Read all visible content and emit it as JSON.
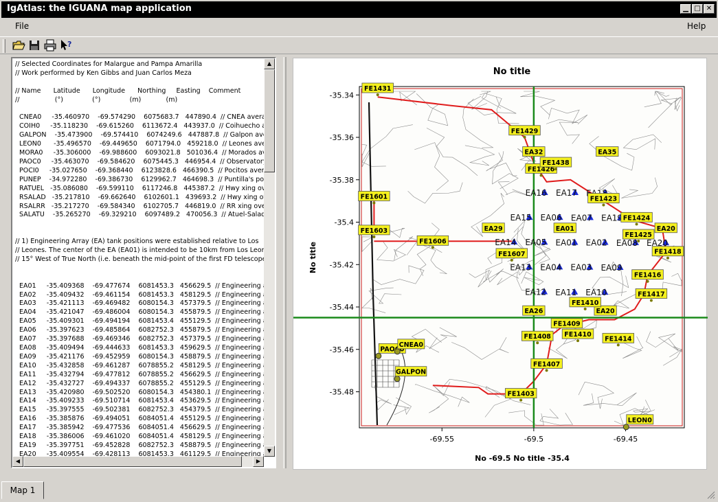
{
  "window": {
    "title": "IgAtlas: the IGUANA map application",
    "controls": {
      "minimize": "▁",
      "maximize": "□",
      "close": "✕"
    }
  },
  "menu": {
    "file": "File",
    "help": "Help"
  },
  "toolbar": {
    "icons": [
      "open-folder-icon",
      "save-disk-icon",
      "print-icon",
      "context-help-icon"
    ]
  },
  "text_lines": [
    "// Selected Coordinates for Malargue and Pampa Amarilla",
    "// Work performed by Ken Gibbs and Juan Carlos Meza",
    "",
    "// Name      Latitude      Longitude      Northing     Easting    Comment",
    "//                 (°)              (°)              (m)            (m)",
    "",
    "  CNEA0     -35.460970    -69.574290    6075683.7   447890.4  // CNEA averag",
    "  COIH0     -35.118230    -69.615260    6113672.4   443937.0  // Coihuecho aver",
    "  GALPON    -35.473900    -69.574410    6074249.6   447887.8  // Galpon avera",
    "  LEON0      -35.496570    -69.449650    6071794.0   459218.0  // Leones averag",
    "  MORA0     -35.306000    -69.988600    6093021.8   501036.4  // Morados aver",
    "  PAOC0     -35.463070    -69.584620    6075445.3   446954.4  // Observatory C",
    "  POCI0     -35.027650    -69.368440    6123828.6   466390.5  // Pocitos averag",
    "  PUNEP    -34.972280    -69.386730    6129962.7   464698.3  // Puntilla's pos",
    "  RATUEL   -35.086080    -69.599110    6117246.8   445387.2  // Hwy xing ove",
    "  RSALAD   -35.217810    -69.662640    6102601.1   439693.2  // Hwy xing over",
    "  RSALRR   -35.217270    -69.584340    6102705.7   446819.0  // RR xing over",
    "  SALATU    -35.265270    -69.329210    6097489.2   470056.3  // Atuel-Salado",
    "",
    "",
    "// 1) Engineering Array (EA) tank positions were established relative to Los",
    "// Leones. The center of the EA (EA01) is intended to be 10km from Los Leones,",
    "// 15° West of True North (i.e. beneath the mid-point of the first FD telescope's a",
    "",
    "",
    "  EA01     -35.409368    -69.477674    6081453.3   456629.5  // Engineering arr",
    "  EA02     -35.409432    -69.461154    6081453.3   458129.5  // Engineering arr",
    "  EA03     -35.421113    -69.469482    6080154.3   457379.5  // Engineering arr",
    "  EA04     -35.421047    -69.486004    6080154.3   455879.5  // Engineering arr",
    "  EA05     -35.409301    -69.494194    6081453.4   455129.5  // Engineering arr",
    "  EA06     -35.397623    -69.485864    6082752.3   455879.5  // Engineering arr",
    "  EA07     -35.397688    -69.469346    6082752.3   457379.5  // Engineering arr",
    "  EA08     -35.409494    -69.444633    6081453.3   459629.5  // Engineering arr",
    "  EA09     -35.421176    -69.452959    6080154.3   458879.5  // Engineering arr",
    "  EA10     -35.432858    -69.461287    6078855.2   458129.5  // Engineering arr",
    "  EA11     -35.432794    -69.477812    6078855.2   456629.5  // Engineering arr",
    "  EA12     -35.432727    -69.494337    6078855.2   455129.5  // Engineering arr",
    "  EA13     -35.420980    -69.502520    6080154.3   454380.1  // Engineering arr",
    "  EA14     -35.409233    -69.510714    6081453.4   453629.5  // Engineering arr",
    "  EA15     -35.397555    -69.502381    6082752.3   454379.5  // Engineering arr",
    "  EA16     -35.385876    -69.494051    6084051.4   455129.5  // Engineering arr",
    "  EA17     -35.385942    -69.477536    6084051.4   456629.5  // Engineering arr",
    "  EA18     -35.386006    -69.461020    6084051.4   458129.5  // Engineering arr",
    "  EA19     -35.397751    -69.452828    6082752.3   458879.5  // Engineering arr",
    "  EA20     -35.409554    -69.428113    6081453.3   461129.5  // Engineering arr"
  ],
  "map": {
    "title": "No title",
    "ylabel": "No title",
    "xlabel": "No -69.5 No title -35.4",
    "xticks": [
      "-69.55",
      "-69.5",
      "-69.45"
    ],
    "yticks": [
      "-35.34",
      "-35.36",
      "-35.38",
      "-35.4",
      "-35.42",
      "-35.44",
      "-35.46",
      "-35.48"
    ],
    "crosshair": {
      "lon": -69.5,
      "lat": -35.445
    },
    "fd_stations": [
      {
        "label": "FE1431",
        "lon": -69.585,
        "lat": -35.337
      },
      {
        "label": "FE1429",
        "lon": -69.505,
        "lat": -35.357
      },
      {
        "label": "FE1601",
        "lon": -69.587,
        "lat": -35.388
      },
      {
        "label": "FE1603",
        "lon": -69.587,
        "lat": -35.404
      },
      {
        "label": "FE1606",
        "lon": -69.555,
        "lat": -35.409
      },
      {
        "label": "FE1607",
        "lon": -69.512,
        "lat": -35.415
      },
      {
        "label": "FE1426",
        "lon": -69.496,
        "lat": -35.375
      },
      {
        "label": "FE1423",
        "lon": -69.462,
        "lat": -35.389
      },
      {
        "label": "FE1424",
        "lon": -69.444,
        "lat": -35.398
      },
      {
        "label": "FE1418",
        "lon": -69.427,
        "lat": -35.414
      },
      {
        "label": "FE1416",
        "lon": -69.438,
        "lat": -35.425
      },
      {
        "label": "FE1417",
        "lon": -69.436,
        "lat": -35.434
      },
      {
        "label": "FE1410",
        "lon": -69.472,
        "lat": -35.438
      },
      {
        "label": "FE1409",
        "lon": -69.482,
        "lat": -35.448
      },
      {
        "label": "FE1410",
        "lon": -69.476,
        "lat": -35.453
      },
      {
        "label": "FE1414",
        "lon": -69.454,
        "lat": -35.455
      },
      {
        "label": "FE1408",
        "lon": -69.498,
        "lat": -35.454
      },
      {
        "label": "FE1407",
        "lon": -69.493,
        "lat": -35.467
      },
      {
        "label": "FE1403",
        "lon": -69.507,
        "lat": -35.481
      },
      {
        "label": "FE1438",
        "lon": -69.488,
        "lat": -35.372
      },
      {
        "label": "FE1425",
        "lon": -69.443,
        "lat": -35.406
      }
    ],
    "ea_tanks": [
      {
        "label": "EA01",
        "lon": -69.4777,
        "lat": -35.4094
      },
      {
        "label": "EA02",
        "lon": -69.4612,
        "lat": -35.4094
      },
      {
        "label": "EA03",
        "lon": -69.4695,
        "lat": -35.4211
      },
      {
        "label": "EA04",
        "lon": -69.486,
        "lat": -35.421
      },
      {
        "label": "EA05",
        "lon": -69.4942,
        "lat": -35.4093
      },
      {
        "label": "EA06",
        "lon": -69.4859,
        "lat": -35.3976
      },
      {
        "label": "EA07",
        "lon": -69.4693,
        "lat": -35.3977
      },
      {
        "label": "EA08",
        "lon": -69.4446,
        "lat": -35.4095
      },
      {
        "label": "EA09",
        "lon": -69.453,
        "lat": -35.4212
      },
      {
        "label": "EA10",
        "lon": -69.4613,
        "lat": -35.4329
      },
      {
        "label": "EA11",
        "lon": -69.4778,
        "lat": -35.4328
      },
      {
        "label": "EA12",
        "lon": -69.4943,
        "lat": -35.4327
      },
      {
        "label": "EA13",
        "lon": -69.5025,
        "lat": -35.421
      },
      {
        "label": "EA14",
        "lon": -69.5107,
        "lat": -35.4092
      },
      {
        "label": "EA15",
        "lon": -69.5024,
        "lat": -35.3976
      },
      {
        "label": "EA16",
        "lon": -69.4941,
        "lat": -35.3859
      },
      {
        "label": "EA17",
        "lon": -69.4775,
        "lat": -35.3859
      },
      {
        "label": "EA18",
        "lon": -69.461,
        "lat": -35.386
      },
      {
        "label": "EA19",
        "lon": -69.4528,
        "lat": -35.3978
      },
      {
        "label": "EA20",
        "lon": -69.4281,
        "lat": -35.4096
      }
    ],
    "ea_labels_highlighted": [
      {
        "label": "EA01",
        "lon": -69.483,
        "lat": -35.403
      },
      {
        "label": "EA20",
        "lon": -69.428,
        "lat": -35.403
      },
      {
        "label": "EA29",
        "lon": -69.522,
        "lat": -35.403
      },
      {
        "label": "EA32",
        "lon": -69.5,
        "lat": -35.367
      },
      {
        "label": "EA35",
        "lon": -69.46,
        "lat": -35.367
      },
      {
        "label": "EA26",
        "lon": -69.5,
        "lat": -35.442
      },
      {
        "label": "EA20",
        "lon": -69.461,
        "lat": -35.442
      }
    ],
    "sites": [
      {
        "label": "PAOC0",
        "lon": -69.5846,
        "lat": -35.4631
      },
      {
        "label": "CNEA0",
        "lon": -69.5743,
        "lat": -35.461
      },
      {
        "label": "GALPON",
        "lon": -69.5744,
        "lat": -35.4739
      },
      {
        "label": "LEON0",
        "lon": -69.4497,
        "lat": -35.4966
      }
    ]
  },
  "status": {
    "tab": "Map 1"
  }
}
